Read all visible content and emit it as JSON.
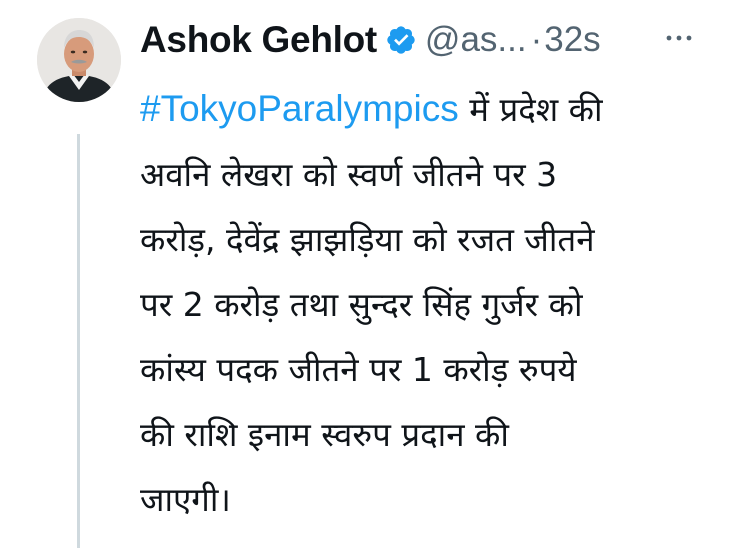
{
  "tweet": {
    "author": {
      "display_name": "Ashok Gehlot",
      "handle": "@as...",
      "verified": true,
      "verified_icon": "verified-badge-icon",
      "avatar_icon": "profile-photo"
    },
    "separator": "·",
    "time": "32s",
    "more_icon": "more-horizontal-icon",
    "hashtag": "#TokyoParalympics",
    "text_lines": [
      " में प्रदेश की",
      "अवनि लेखरा को स्वर्ण जीतने पर 3",
      "करोड़, देवेंद्र झाझड़िया को रजत जीतने",
      "पर 2 करोड़ तथा सुन्दर सिंह गुर्जर को",
      "कांस्य पदक जीतने पर 1 करोड़ रुपये",
      "की राशि इनाम स्वरुप प्रदान की",
      "जाएगी।"
    ]
  },
  "colors": {
    "hashtag": "#1d9bf0",
    "verified_badge": "#1d9bf0",
    "text": "#0f1419",
    "secondary": "#536471",
    "thread_line": "#cfd9de"
  }
}
